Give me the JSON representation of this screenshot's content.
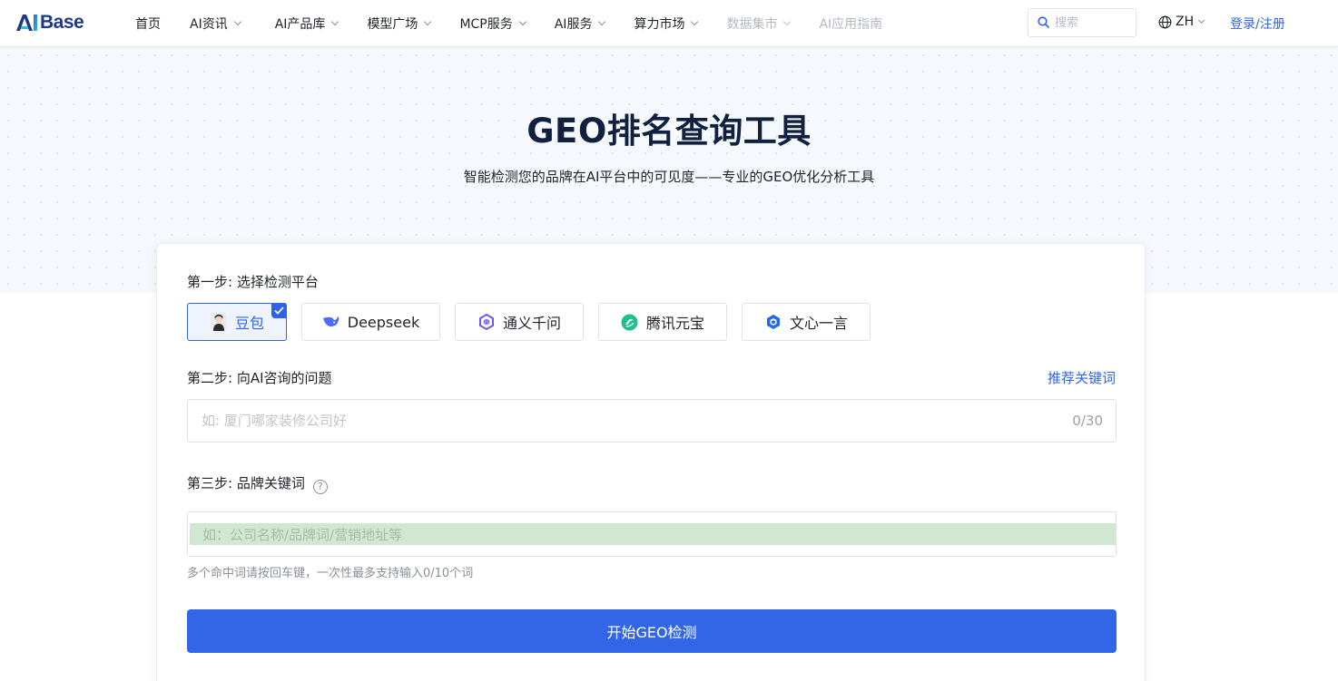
{
  "header": {
    "logo_text": "Base",
    "logo_mark": "AI",
    "nav": [
      {
        "label": "首页",
        "dropdown": false,
        "disabled": false
      },
      {
        "label": "AI资讯",
        "dropdown": true,
        "disabled": false
      },
      {
        "label": "AI产品库",
        "dropdown": true,
        "disabled": false
      },
      {
        "label": "模型广场",
        "dropdown": true,
        "disabled": false
      },
      {
        "label": "MCP服务",
        "dropdown": true,
        "disabled": false
      },
      {
        "label": "AI服务",
        "dropdown": true,
        "disabled": false
      },
      {
        "label": "算力市场",
        "dropdown": true,
        "disabled": false
      },
      {
        "label": "数据集市",
        "dropdown": true,
        "disabled": true
      },
      {
        "label": "AI应用指南",
        "dropdown": false,
        "disabled": true
      }
    ],
    "search_placeholder": "搜索",
    "lang": "ZH",
    "login": "登录/注册"
  },
  "hero": {
    "title": "GEO排名查询工具",
    "subtitle": "智能检测您的品牌在AI平台中的可见度——专业的GEO优化分析工具"
  },
  "form": {
    "step1_label": "第一步: 选择检测平台",
    "platforms": [
      {
        "label": "豆包",
        "icon": "doubao-avatar-icon",
        "selected": true
      },
      {
        "label": "Deepseek",
        "icon": "deepseek-whale-icon",
        "selected": false
      },
      {
        "label": "通义千问",
        "icon": "tongyi-icon",
        "selected": false
      },
      {
        "label": "腾讯元宝",
        "icon": "yuanbao-icon",
        "selected": false
      },
      {
        "label": "文心一言",
        "icon": "wenxin-icon",
        "selected": false
      }
    ],
    "step2_label": "第二步: 向AI咨询的问题",
    "suggest_link": "推荐关键词",
    "question_placeholder": "如: 厦门哪家装修公司好",
    "question_count": "0/30",
    "step3_label": "第三步: 品牌关键词",
    "keyword_placeholder": "如：公司名称/品牌词/营销地址等",
    "keyword_hint": "多个命中词请按回车键，一次性最多支持输入0/10个词",
    "submit_label": "开始GEO检测"
  },
  "colors": {
    "accent": "#2f63e8",
    "button": "#3366e6",
    "title": "#10213f"
  }
}
